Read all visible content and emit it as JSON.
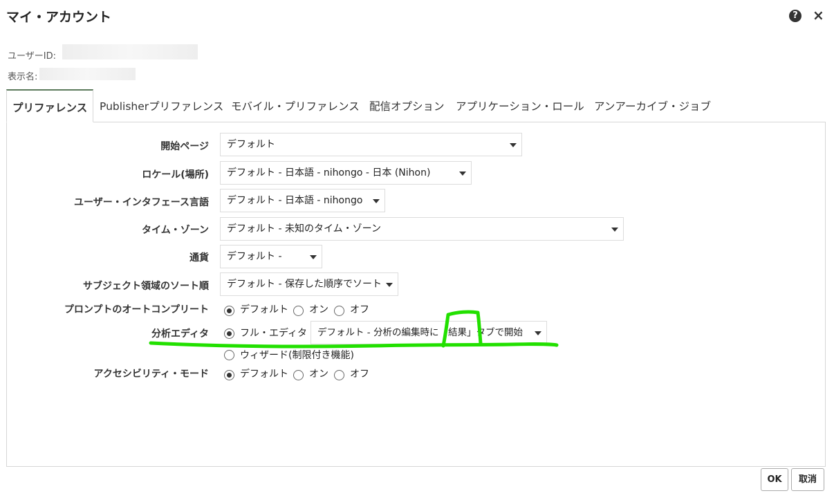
{
  "dialog": {
    "title": "マイ・アカウント",
    "help_icon": "?",
    "close_icon": "×"
  },
  "user": {
    "id_label": "ユーザーID:",
    "name_label": "表示名:"
  },
  "tabs": [
    {
      "label": "プリファレンス",
      "active": true
    },
    {
      "label": "Publisherプリファレンス"
    },
    {
      "label": "モバイル・プリファレンス"
    },
    {
      "label": "配信オプション"
    },
    {
      "label": "アプリケーション・ロール"
    },
    {
      "label": "アンアーカイブ・ジョブ"
    }
  ],
  "prefs": {
    "start_page": {
      "label": "開始ページ",
      "value": "デフォルト"
    },
    "locale": {
      "label": "ロケール(場所)",
      "value": "デフォルト - 日本語 - nihongo - 日本 (Nihon)"
    },
    "ui_language": {
      "label": "ユーザー・インタフェース言語",
      "value": "デフォルト - 日本語 - nihongo"
    },
    "timezone": {
      "label": "タイム・ゾーン",
      "value": "デフォルト - 未知のタイム・ゾーン"
    },
    "currency": {
      "label": "通貨",
      "value": "デフォルト -"
    },
    "subject_sort": {
      "label": "サブジェクト領域のソート順",
      "value": "デフォルト - 保存した順序でソート"
    },
    "prompt_autocomplete": {
      "label": "プロンプトのオートコンプリート",
      "options": [
        "デフォルト",
        "オン",
        "オフ"
      ],
      "selected": "デフォルト"
    },
    "analysis_editor": {
      "label": "分析エディタ",
      "full_option": "フル・エディタ",
      "full_select_value": "デフォルト - 分析の編集時に「結果」タブで開始",
      "wizard_option": "ウィザード(制限付き機能)",
      "selected": "フル・エディタ"
    },
    "accessibility": {
      "label": "アクセシビリティ・モード",
      "options": [
        "デフォルト",
        "オン",
        "オフ"
      ],
      "selected": "デフォルト"
    }
  },
  "footer": {
    "ok_label": "OK",
    "cancel_label": "取消"
  },
  "colors": {
    "annotation": "#22e000",
    "tab_accent": "#5a7a5a"
  }
}
